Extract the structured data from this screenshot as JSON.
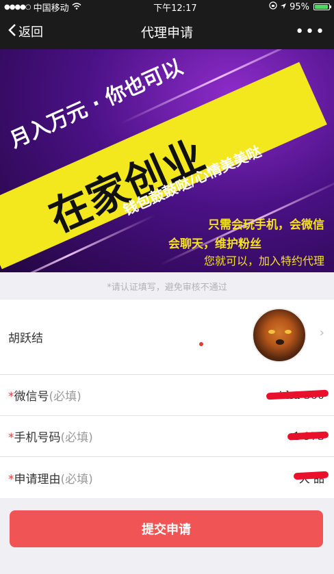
{
  "status_bar": {
    "carrier": "中国移动",
    "time": "下午12:17",
    "battery": "95%",
    "battery_level": 0.95
  },
  "nav": {
    "back_label": "返回",
    "title": "代理申请",
    "more_label": "•••"
  },
  "banner": {
    "line1": "月入万元 · 你也可以",
    "line2": "在家创业",
    "line3": "钱包鼓鼓哒/心情美美哒",
    "line4": "只需会玩手机，会微信",
    "line5": "会聊天，维护粉丝",
    "line6": "您就可以，加入特约代理"
  },
  "notice": "*请认证填写，避免审核不通过",
  "form": {
    "name": "胡跃结",
    "fields": [
      {
        "required": "*",
        "label": "微信号",
        "hint": "(必填)",
        "value": "ni   hu   360"
      },
      {
        "required": "*",
        "label": "手机号码",
        "hint": "(必填)",
        "value": "1        973"
      },
      {
        "required": "*",
        "label": "申请理由",
        "hint": "(必填)",
        "value": "大         品"
      }
    ]
  },
  "submit_label": "提交申请",
  "colors": {
    "accent": "#f05454",
    "required": "#e53935",
    "nav_bg": "#1b1b1b"
  }
}
